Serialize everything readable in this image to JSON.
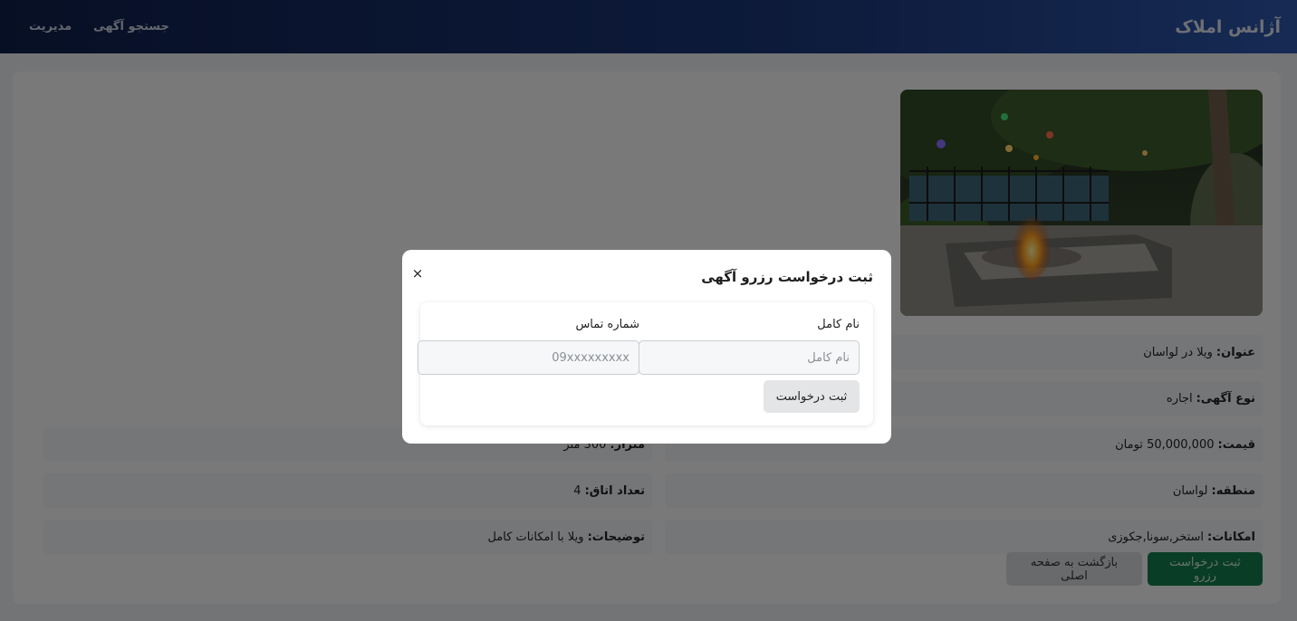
{
  "header": {
    "brand": "آژانس املاک",
    "nav": [
      "جستجو آگهی",
      "مدیریت"
    ]
  },
  "listing": {
    "details": {
      "title": {
        "label": "عنوان:",
        "value": "ویلا در لواسان"
      },
      "type": {
        "label": "نوع آگهی:",
        "value": "اجاره"
      },
      "price": {
        "label": "قیمت:",
        "value": "50,000,000 تومان"
      },
      "area": {
        "label": "متراژ:",
        "value": "300 متر"
      },
      "region": {
        "label": "منطقه:",
        "value": "لواسان"
      },
      "rooms": {
        "label": "تعداد اتاق:",
        "value": "4"
      },
      "amenities": {
        "label": "امکانات:",
        "value": "استخر,سونا,جکوزی"
      },
      "description": {
        "label": "توضیحات:",
        "value": "ویلا با امکانات کامل"
      }
    },
    "buttons": {
      "reserve": "ثبت درخواست رزرو",
      "back": "بازگشت به صفحه اصلی"
    }
  },
  "modal": {
    "title": "ثبت درخواست رزرو آگهی",
    "close": "×",
    "name_label": "نام کامل",
    "name_placeholder": "نام کامل",
    "phone_label": "شماره تماس",
    "phone_placeholder": "09xxxxxxxxx",
    "submit": "ثبت درخواست"
  },
  "colors": {
    "header_start": "#0f1f4a",
    "header_end": "#2d55a8",
    "reserve_button": "#157a4d"
  }
}
